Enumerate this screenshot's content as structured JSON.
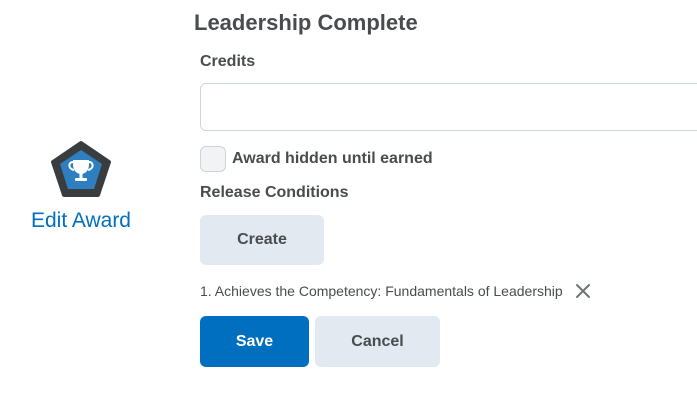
{
  "award": {
    "icon": "trophy-badge-icon",
    "edit_link": "Edit Award"
  },
  "form": {
    "title": "Leadership Complete",
    "credits_label": "Credits",
    "credits_value": "",
    "credits_placeholder": "",
    "hidden_checkbox_label": "Award hidden until earned",
    "hidden_checked": false,
    "release_conditions_label": "Release Conditions",
    "create_button": "Create",
    "conditions": [
      {
        "text": "1. Achieves the Competency: Fundamentals of Leadership"
      }
    ],
    "save_button": "Save",
    "cancel_button": "Cancel"
  },
  "colors": {
    "accent": "#006fbf",
    "text": "#494c4e",
    "secondary_button": "#e3e9f1",
    "badge_fill": "#2f7fc0",
    "badge_border": "#3a3d40"
  }
}
